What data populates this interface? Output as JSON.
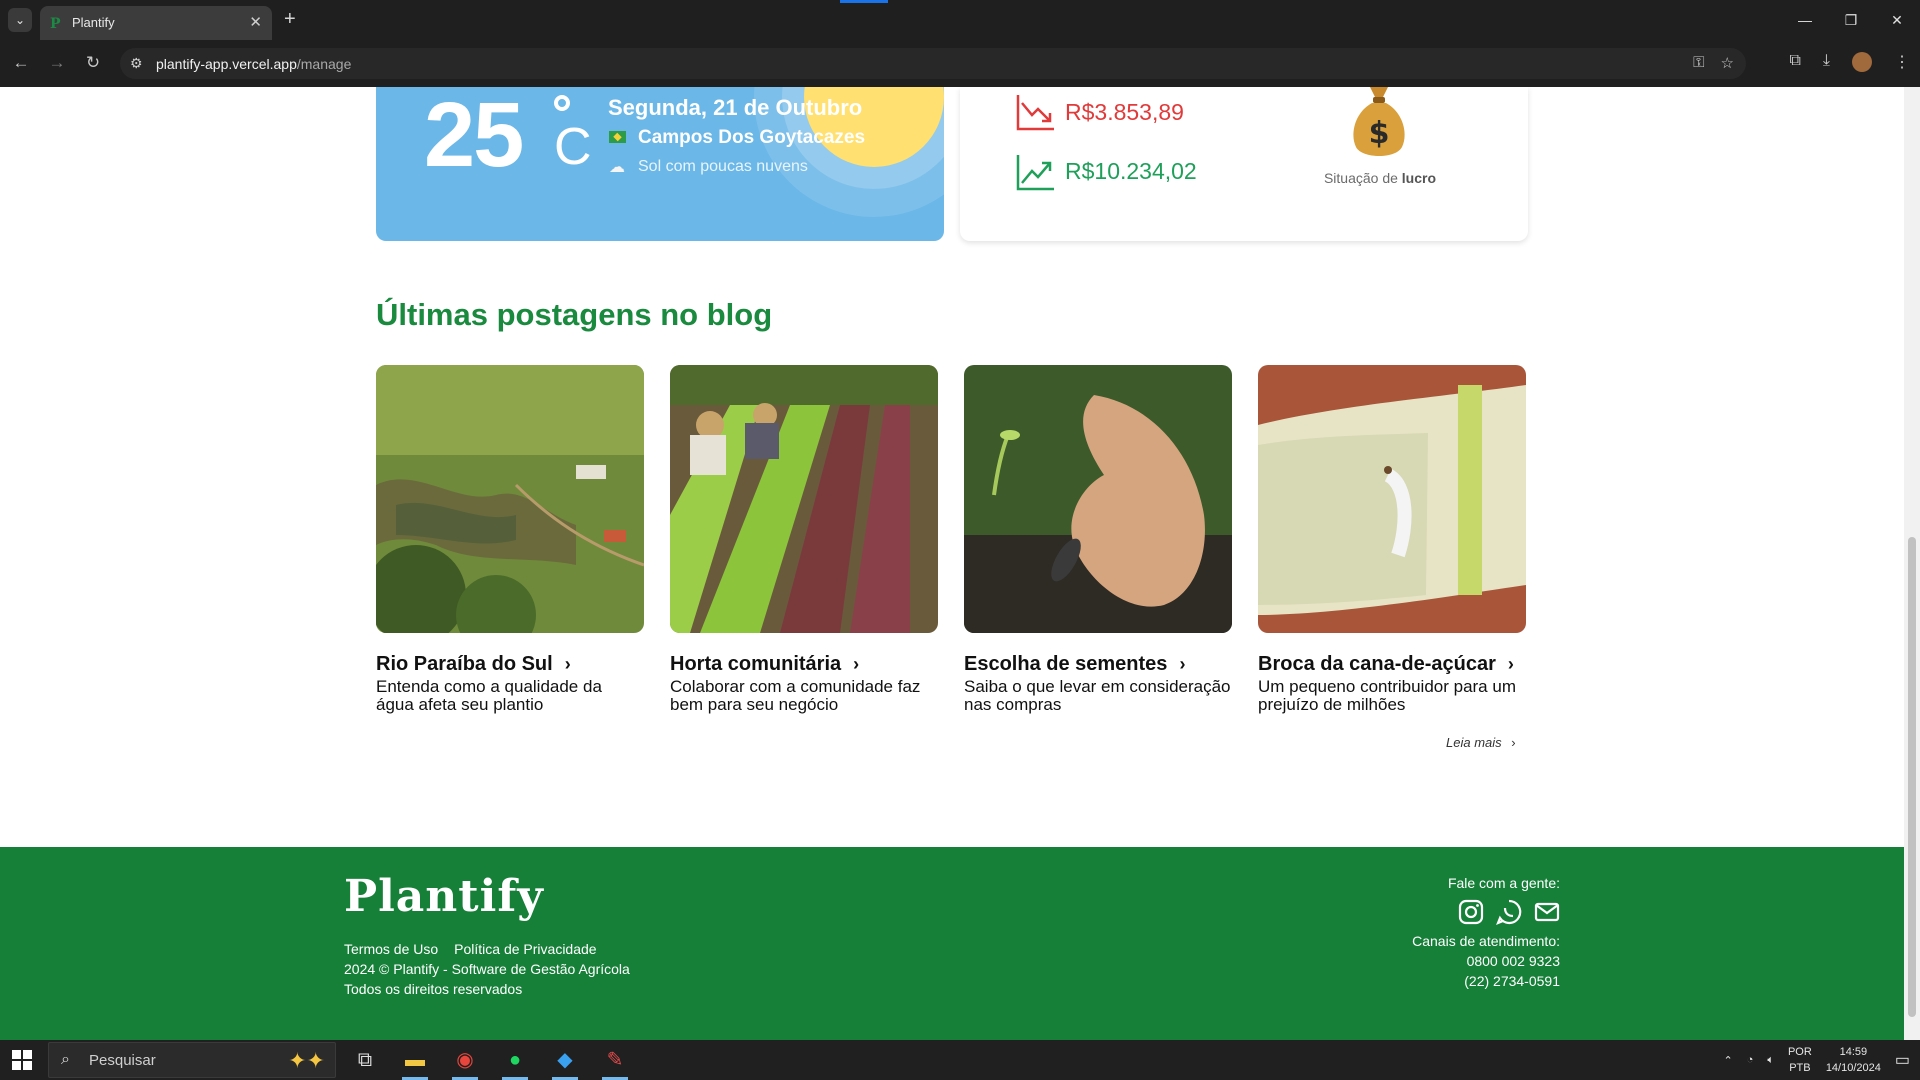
{
  "browser": {
    "tab_title": "Plantify",
    "new_tab": "+",
    "url_host": "plantify-app.vercel.app",
    "url_path": "/manage",
    "win_minimize": "—",
    "win_restore": "❐",
    "win_close": "✕"
  },
  "weather": {
    "temperature": "25",
    "unit": "C",
    "date": "Segunda, 21 de Outubro",
    "city": "Campos Dos Goytacazes",
    "description": "Sol com poucas nuvens"
  },
  "finance": {
    "expense": "R$3.853,89",
    "income": "R$10.234,02",
    "status_prefix": "Situação de ",
    "status_value": "lucro",
    "colors": {
      "expense": "#e03a3a",
      "income": "#1fa05a"
    }
  },
  "blog": {
    "title": "Últimas postagens no blog",
    "posts": [
      {
        "title": "Rio Paraíba do Sul",
        "description": "Entenda como a qualidade da água afeta seu plantio"
      },
      {
        "title": "Horta comunitária",
        "description": "Colaborar com a comunidade faz bem para seu negócio"
      },
      {
        "title": "Escolha de sementes",
        "description": "Saiba o que levar em consideração nas compras"
      },
      {
        "title": "Broca da cana-de-açúcar",
        "description": "Um pequeno contribuidor para um prejuízo de milhões"
      }
    ],
    "read_more": "Leia mais"
  },
  "footer": {
    "brand": "Plantify",
    "terms": "Termos de Uso",
    "privacy": "Política de Privacidade",
    "copyright": "2024 © Plantify - Software de Gestão Agrícola",
    "rights": "Todos os direitos reservados",
    "contact_title": "Fale com a gente:",
    "channels_title": "Canais de atendimento:",
    "phone1": "0800 002 9323",
    "phone2": "(22) 2734-0591",
    "brand_color": "#168039"
  },
  "taskbar": {
    "search_placeholder": "Pesquisar",
    "lang": "POR",
    "layout": "PTB",
    "time": "14:59",
    "date": "14/10/2024"
  }
}
